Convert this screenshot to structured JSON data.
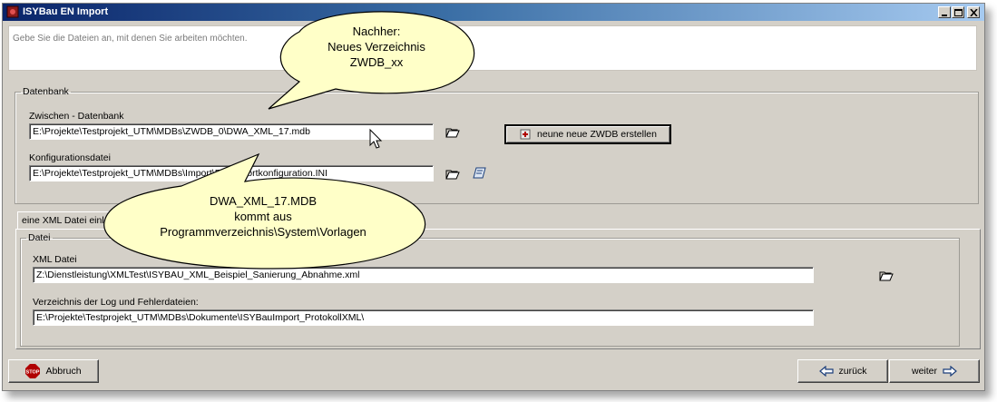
{
  "window": {
    "title": "ISYBau EN Import"
  },
  "header": {
    "hint": "Gebe Sie die Dateien an, mit denen Sie arbeiten möchten."
  },
  "datenbank": {
    "legend": "Datenbank",
    "zwdb_label": "Zwischen - Datenbank",
    "zwdb_value": "E:\\Projekte\\Testprojekt_UTM\\MDBs\\ZWDB_0\\DWA_XML_17.mdb",
    "config_label": "Konfigurationsdatei",
    "config_value": "E:\\Projekte\\Testprojekt_UTM\\MDBs\\Import\\EN-Importkonfiguration.INI",
    "new_zwdb_button": "neune neue ZWDB erstellen"
  },
  "tab": {
    "label": "eine XML Datei einlesen"
  },
  "datei": {
    "legend": "Datei",
    "xml_label": "XML Datei",
    "xml_value": "Z:\\Dienstleistung\\XMLTest\\ISYBAU_XML_Beispiel_Sanierung_Abnahme.xml",
    "log_label": "Verzeichnis der Log und Fehlerdateien:",
    "log_value": "E:\\Projekte\\Testprojekt_UTM\\MDBs\\Dokumente\\ISYBauImport_ProtokollXML\\"
  },
  "buttons": {
    "abbruch": "Abbruch",
    "zurueck": "zurück",
    "weiter": "weiter"
  },
  "callouts": {
    "top": [
      "Nachher:",
      "Neues Verzeichnis",
      "ZWDB_xx"
    ],
    "bottom": [
      "DWA_XML_17.MDB",
      "kommt aus",
      "Programmverzeichnis\\System\\Vorlagen"
    ]
  },
  "colors": {
    "titlebar_start": "#0a246a",
    "titlebar_end": "#a6caf0",
    "dialog_bg": "#d4d0c8",
    "callout_fill": "#ffffc8"
  }
}
